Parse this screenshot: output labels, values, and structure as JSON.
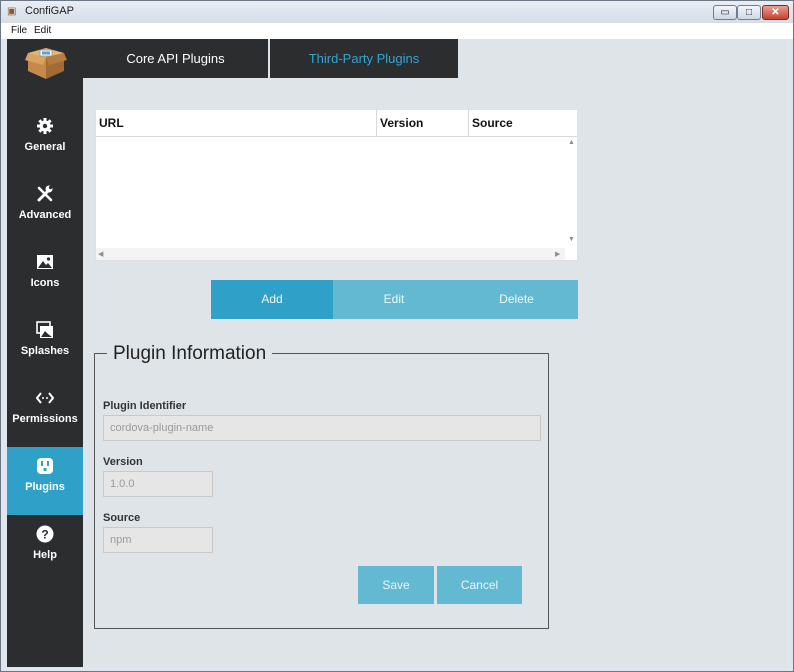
{
  "window": {
    "title": "ConfiGAP",
    "minimize": "▭",
    "maximize": "□",
    "close": "✕"
  },
  "menu": [
    "File",
    "Edit"
  ],
  "sidebar": {
    "items": [
      {
        "label": "General",
        "icon": "gear-icon"
      },
      {
        "label": "Advanced",
        "icon": "tools-icon"
      },
      {
        "label": "Icons",
        "icon": "image-icon"
      },
      {
        "label": "Splashes",
        "icon": "images-icon"
      },
      {
        "label": "Permissions",
        "icon": "code-icon"
      },
      {
        "label": "Plugins",
        "icon": "plug-icon"
      },
      {
        "label": "Help",
        "icon": "question-icon"
      }
    ],
    "active": "Plugins",
    "active_color": "#2fa1c8"
  },
  "tabs": [
    "Core API Plugins",
    "Third-Party Plugins"
  ],
  "table": {
    "columns": [
      "URL",
      "Version",
      "Source"
    ],
    "rows": []
  },
  "actions": {
    "add": "Add",
    "edit": "Edit",
    "delete": "Delete"
  },
  "plugin_info": {
    "legend": "Plugin Information",
    "identifier_label": "Plugin Identifier",
    "identifier_placeholder": "cordova-plugin-name",
    "version_label": "Version",
    "version_placeholder": "1.0.0",
    "source_label": "Source",
    "source_placeholder": "npm",
    "save": "Save",
    "cancel": "Cancel"
  }
}
